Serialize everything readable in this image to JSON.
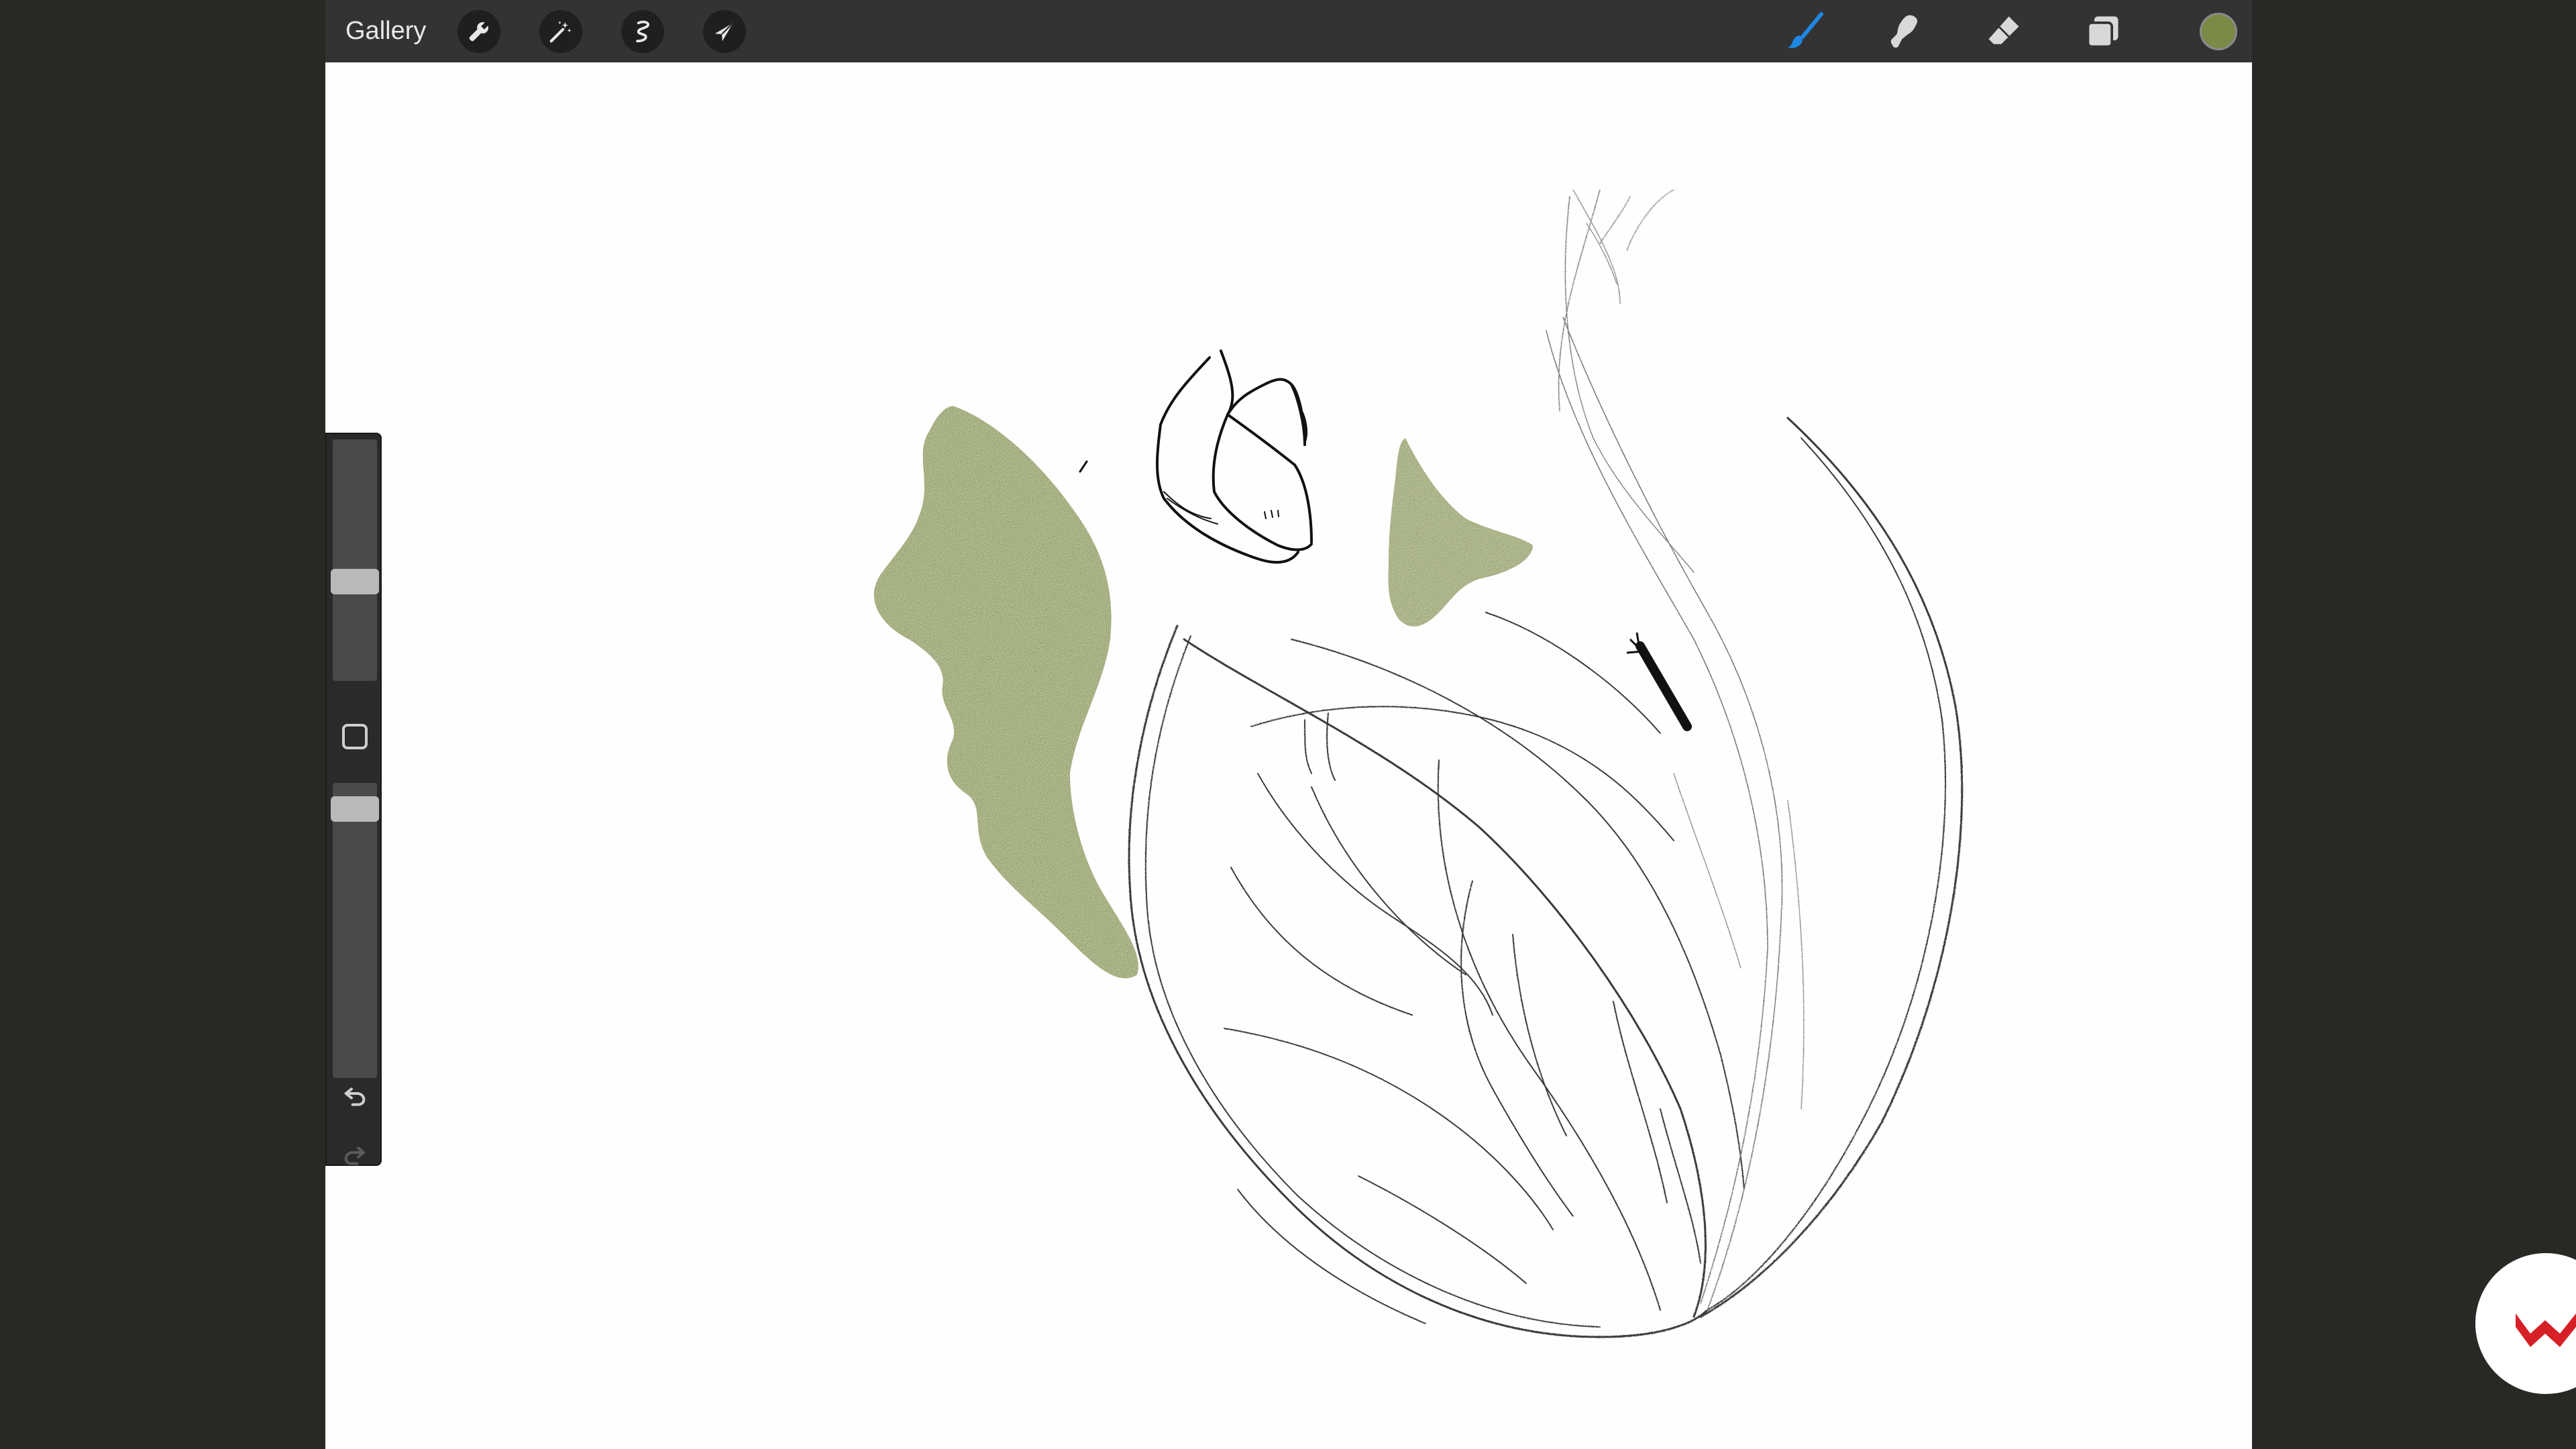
{
  "topbar": {
    "gallery_label": "Gallery",
    "left_tools": [
      "wrench-icon",
      "magic-wand-icon",
      "selection-icon",
      "move-arrow-icon"
    ],
    "right_tools": [
      "brush-icon",
      "smudge-icon",
      "eraser-icon",
      "layers-icon"
    ],
    "active_tool": "brush-icon",
    "accent_color": "#1e88e5",
    "current_color": "#7b8a47"
  },
  "sidebar": {
    "brush_size_level": 0.4,
    "opacity_level": 0.95,
    "icons": [
      "modifier-square-icon",
      "undo-icon",
      "redo-icon"
    ]
  },
  "canvas": {
    "background": "#fefefe",
    "paint_color": "#7b8a47",
    "stroke_color": "#2a2a2a"
  },
  "watermark": {
    "logo_color": "#d61f26"
  }
}
